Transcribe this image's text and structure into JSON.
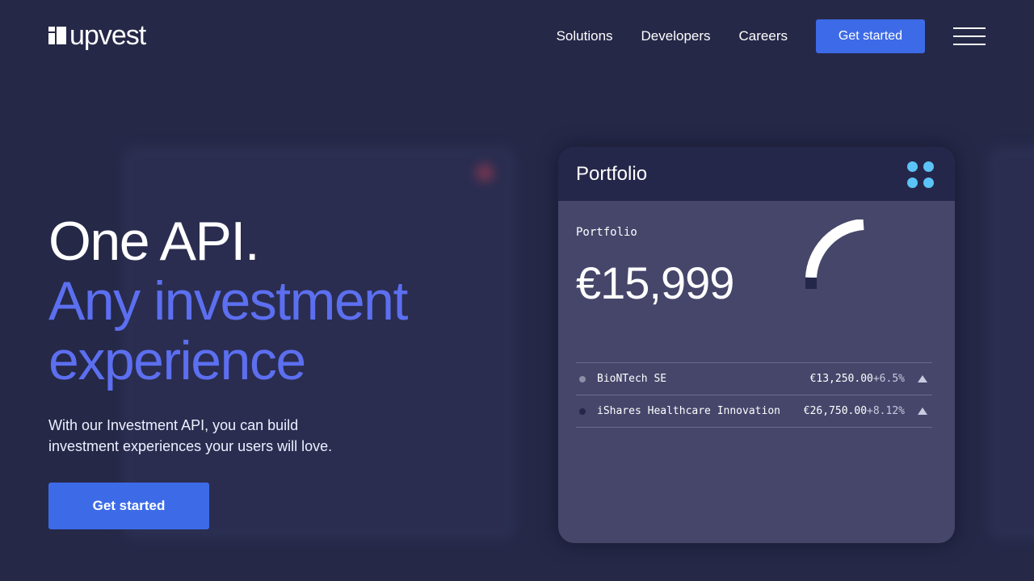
{
  "brand": {
    "name": "upvest"
  },
  "nav": {
    "items": [
      {
        "label": "Solutions"
      },
      {
        "label": "Developers"
      },
      {
        "label": "Careers"
      }
    ],
    "cta_label": "Get started"
  },
  "hero": {
    "line1": "One API.",
    "line2": "Any investment",
    "line3": "experience",
    "subtitle": "With our Investment API, you can build investment experiences your users will love.",
    "cta_label": "Get started"
  },
  "card": {
    "title": "Portfolio",
    "label": "Portfolio",
    "amount": "€15,999",
    "holdings": [
      {
        "name": "BioNTech SE",
        "value": "€13,250.00",
        "change": "+6.5%",
        "dot_color": "#8c8da6"
      },
      {
        "name": "iShares Healthcare Innovation",
        "value": "€26,750.00",
        "change": "+8.12%",
        "dot_color": "#25274a"
      }
    ]
  },
  "colors": {
    "background": "#252847",
    "accent": "#3d6be8",
    "headline_blue": "#5c6ff0",
    "card_header": "#25274a",
    "card_body": "#45466a",
    "dots": "#5bc3f7"
  }
}
